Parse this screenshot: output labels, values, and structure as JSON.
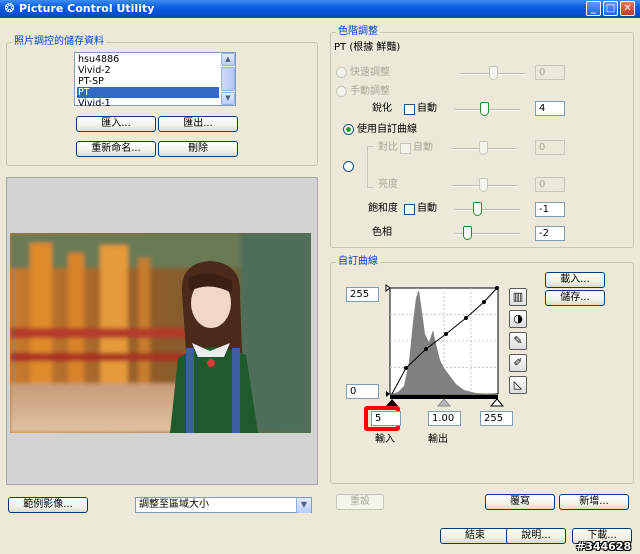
{
  "window": {
    "title": "Picture Control Utility",
    "app_icon": "camera-icon",
    "minimize": "_",
    "maximize": "□",
    "close": "✕"
  },
  "saved": {
    "group_label": "照片調控的儲存資料",
    "items": [
      "hsu4886",
      "Vivid-2",
      "PT-SP",
      "PT",
      "Vivid-1"
    ],
    "selected": "PT",
    "import_label": "匯入...",
    "export_label": "匯出...",
    "rename_label": "重新命名...",
    "delete_label": "刪除"
  },
  "preview": {
    "sample_button": "範例影像...",
    "fit_option": "調整至區域大小"
  },
  "color_adjust": {
    "group_label": "色階調整",
    "subtitle": "PT (根據 鮮豔)",
    "quick_label": "快速調整",
    "quick_value": "0",
    "manual_label": "手動調整",
    "sharpen_label": "銳化",
    "auto_label": "自動",
    "sharpen_value": "4",
    "custom_curve_label": "使用自訂曲線",
    "contrast_label": "對比",
    "contrast_value": "0",
    "brightness_label": "亮度",
    "brightness_value": "0",
    "saturation_label": "飽和度",
    "saturation_value": "-1",
    "hue_label": "色相",
    "hue_value": "-2"
  },
  "custom_curve": {
    "group_label": "自訂曲線",
    "load_label": "載入...",
    "save_label": "儲存...",
    "output_max": "255",
    "output_min": "0",
    "input_low": "5",
    "gamma": "1.00",
    "input_high": "255",
    "input_label": "輸入",
    "output_label": "輸出",
    "reset_label": "重設",
    "overwrite_label": "覆寫",
    "add_label": "新增..."
  },
  "footer": {
    "exit_label": "結束",
    "help_label": "說明...",
    "download_label": "下載...",
    "watermark": "#344628"
  },
  "colors": {
    "accent": "#0046d5",
    "highlight": "#ff0000",
    "selection": "#316ac5"
  }
}
